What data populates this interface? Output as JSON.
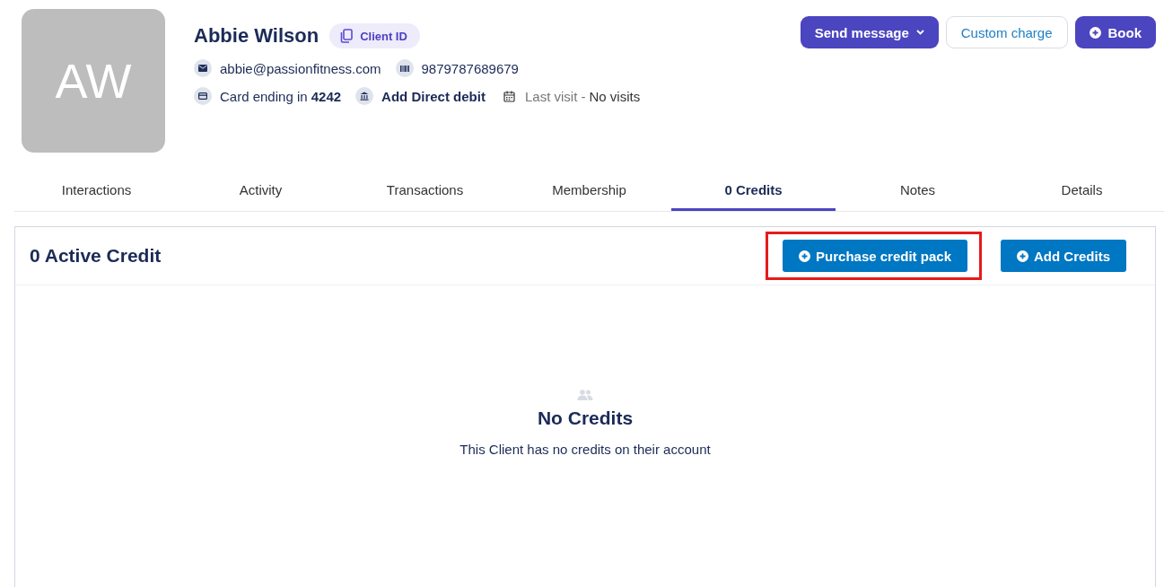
{
  "client": {
    "initials": "AW",
    "name": "Abbie Wilson",
    "client_id_label": "Client ID",
    "email": "abbie@passionfitness.com",
    "barcode": "9879787689679",
    "card": "Card ending in **4242**",
    "direct_debit": "Add Direct debit",
    "last_visit_label": "Last visit -",
    "last_visit_value": "No visits"
  },
  "actions": [
    {
      "kind": "dropdown",
      "label": "Send message"
    },
    {
      "kind": "outline",
      "label": "Custom charge"
    },
    {
      "kind": "add",
      "label": "Book"
    }
  ],
  "tabs": [
    {
      "label": "Interactions",
      "selected": false
    },
    {
      "label": "Activity",
      "selected": false
    },
    {
      "label": "Transactions",
      "selected": false
    },
    {
      "label": "Membership",
      "selected": false
    },
    {
      "label": "0 Credits",
      "selected": true
    },
    {
      "label": "Notes",
      "selected": false
    },
    {
      "label": "Details",
      "selected": false
    }
  ],
  "panel": {
    "title": "0 Active Credit",
    "buttons": [
      {
        "label": "Purchase credit pack",
        "kind": "highlighted"
      },
      {
        "label": "Add Credits",
        "kind": "plain"
      }
    ],
    "empty_title": "No Credits",
    "empty_text": "This Client has no credits on their account"
  }
}
